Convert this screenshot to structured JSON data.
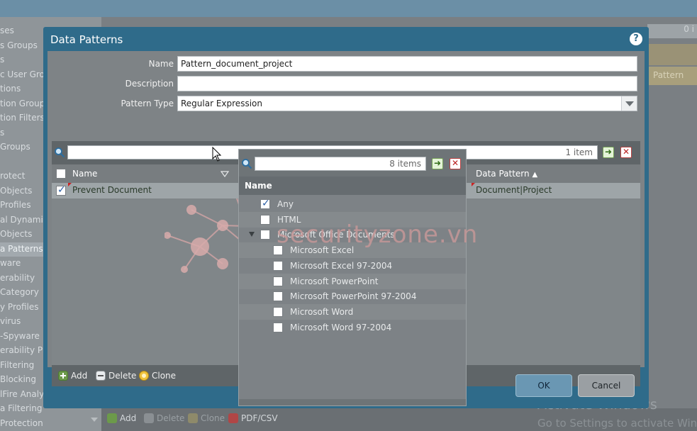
{
  "background": {
    "sidebar_items": [
      {
        "label": "ses",
        "active": false
      },
      {
        "label": "s Groups",
        "active": false
      },
      {
        "label": "s",
        "active": false
      },
      {
        "label": "c User Gro",
        "active": false
      },
      {
        "label": "tions",
        "active": false
      },
      {
        "label": "tion Groups",
        "active": false
      },
      {
        "label": "tion Filters",
        "active": false
      },
      {
        "label": "s",
        "active": false
      },
      {
        "label": "Groups",
        "active": false
      },
      {
        "label": "",
        "active": false
      },
      {
        "label": "rotect",
        "active": false
      },
      {
        "label": "Objects",
        "active": false
      },
      {
        "label": "Profiles",
        "active": false
      },
      {
        "label": "al Dynamic",
        "active": false
      },
      {
        "label": "Objects",
        "active": false
      },
      {
        "label": "a Patterns",
        "active": true
      },
      {
        "label": "ware",
        "active": false
      },
      {
        "label": "erability",
        "active": false
      },
      {
        "label": "Category",
        "active": false
      },
      {
        "label": "y Profiles",
        "active": false
      },
      {
        "label": "virus",
        "active": false
      },
      {
        "label": "-Spyware",
        "active": false
      },
      {
        "label": "erability Pr",
        "active": false
      },
      {
        "label": "Filtering",
        "active": false
      },
      {
        "label": "Blocking",
        "active": false
      },
      {
        "label": "lFire Analys",
        "active": false
      },
      {
        "label": "a Filtering",
        "active": false
      },
      {
        "label": "Protection",
        "active": false
      }
    ],
    "search_count": "0 i",
    "row_text": "Pattern",
    "bottom_actions": {
      "add": "Add",
      "delete": "Delete",
      "clone": "Clone",
      "pdf_csv": "PDF/CSV"
    },
    "activate_line1": "Activate Windows",
    "activate_line2": "Go to Settings to activate Wind"
  },
  "dialog": {
    "title": "Data Patterns",
    "fields": {
      "name_label": "Name",
      "name_value": "Pattern_document_project",
      "description_label": "Description",
      "description_value": "",
      "pattern_type_label": "Pattern Type",
      "pattern_type_value": "Regular Expression"
    },
    "table": {
      "search_count": "1 item",
      "columns": {
        "name": "Name",
        "data_pattern": "Data Pattern"
      },
      "rows": [
        {
          "name": "Prevent Document",
          "data_pattern": "Document|Project",
          "checked": true
        }
      ],
      "footer": {
        "add": "Add",
        "delete": "Delete",
        "clone": "Clone"
      }
    },
    "filter_dropdown": {
      "search_count": "8 items",
      "header": "Name",
      "items": [
        {
          "label": "Any",
          "checked": true,
          "indent": 0,
          "expandable": false
        },
        {
          "label": "HTML",
          "checked": false,
          "indent": 0,
          "expandable": false
        },
        {
          "label": "Microsoft Office Documents",
          "checked": false,
          "indent": 0,
          "expandable": true
        },
        {
          "label": "Microsoft Excel",
          "checked": false,
          "indent": 1,
          "expandable": false
        },
        {
          "label": "Microsoft Excel 97-2004",
          "checked": false,
          "indent": 1,
          "expandable": false
        },
        {
          "label": "Microsoft PowerPoint",
          "checked": false,
          "indent": 1,
          "expandable": false
        },
        {
          "label": "Microsoft PowerPoint 97-2004",
          "checked": false,
          "indent": 1,
          "expandable": false
        },
        {
          "label": "Microsoft Word",
          "checked": false,
          "indent": 1,
          "expandable": false
        },
        {
          "label": "Microsoft Word 97-2004",
          "checked": false,
          "indent": 1,
          "expandable": false
        }
      ]
    },
    "buttons": {
      "ok": "OK",
      "cancel": "Cancel"
    }
  },
  "watermark": {
    "text": "securityzone.vn"
  },
  "colors": {
    "dialog_blue": "#2f6b8a",
    "accent_green": "#79a45a",
    "delete_red": "#b22222"
  },
  "icons": [
    "help-icon",
    "search-icon",
    "go-arrow-icon",
    "clear-x-icon",
    "add-icon",
    "delete-icon",
    "clone-icon",
    "pdf-csv-icon",
    "sort-asc-icon",
    "filter-dropdown-icon",
    "expand-triangle-icon",
    "mouse-cursor-icon"
  ]
}
